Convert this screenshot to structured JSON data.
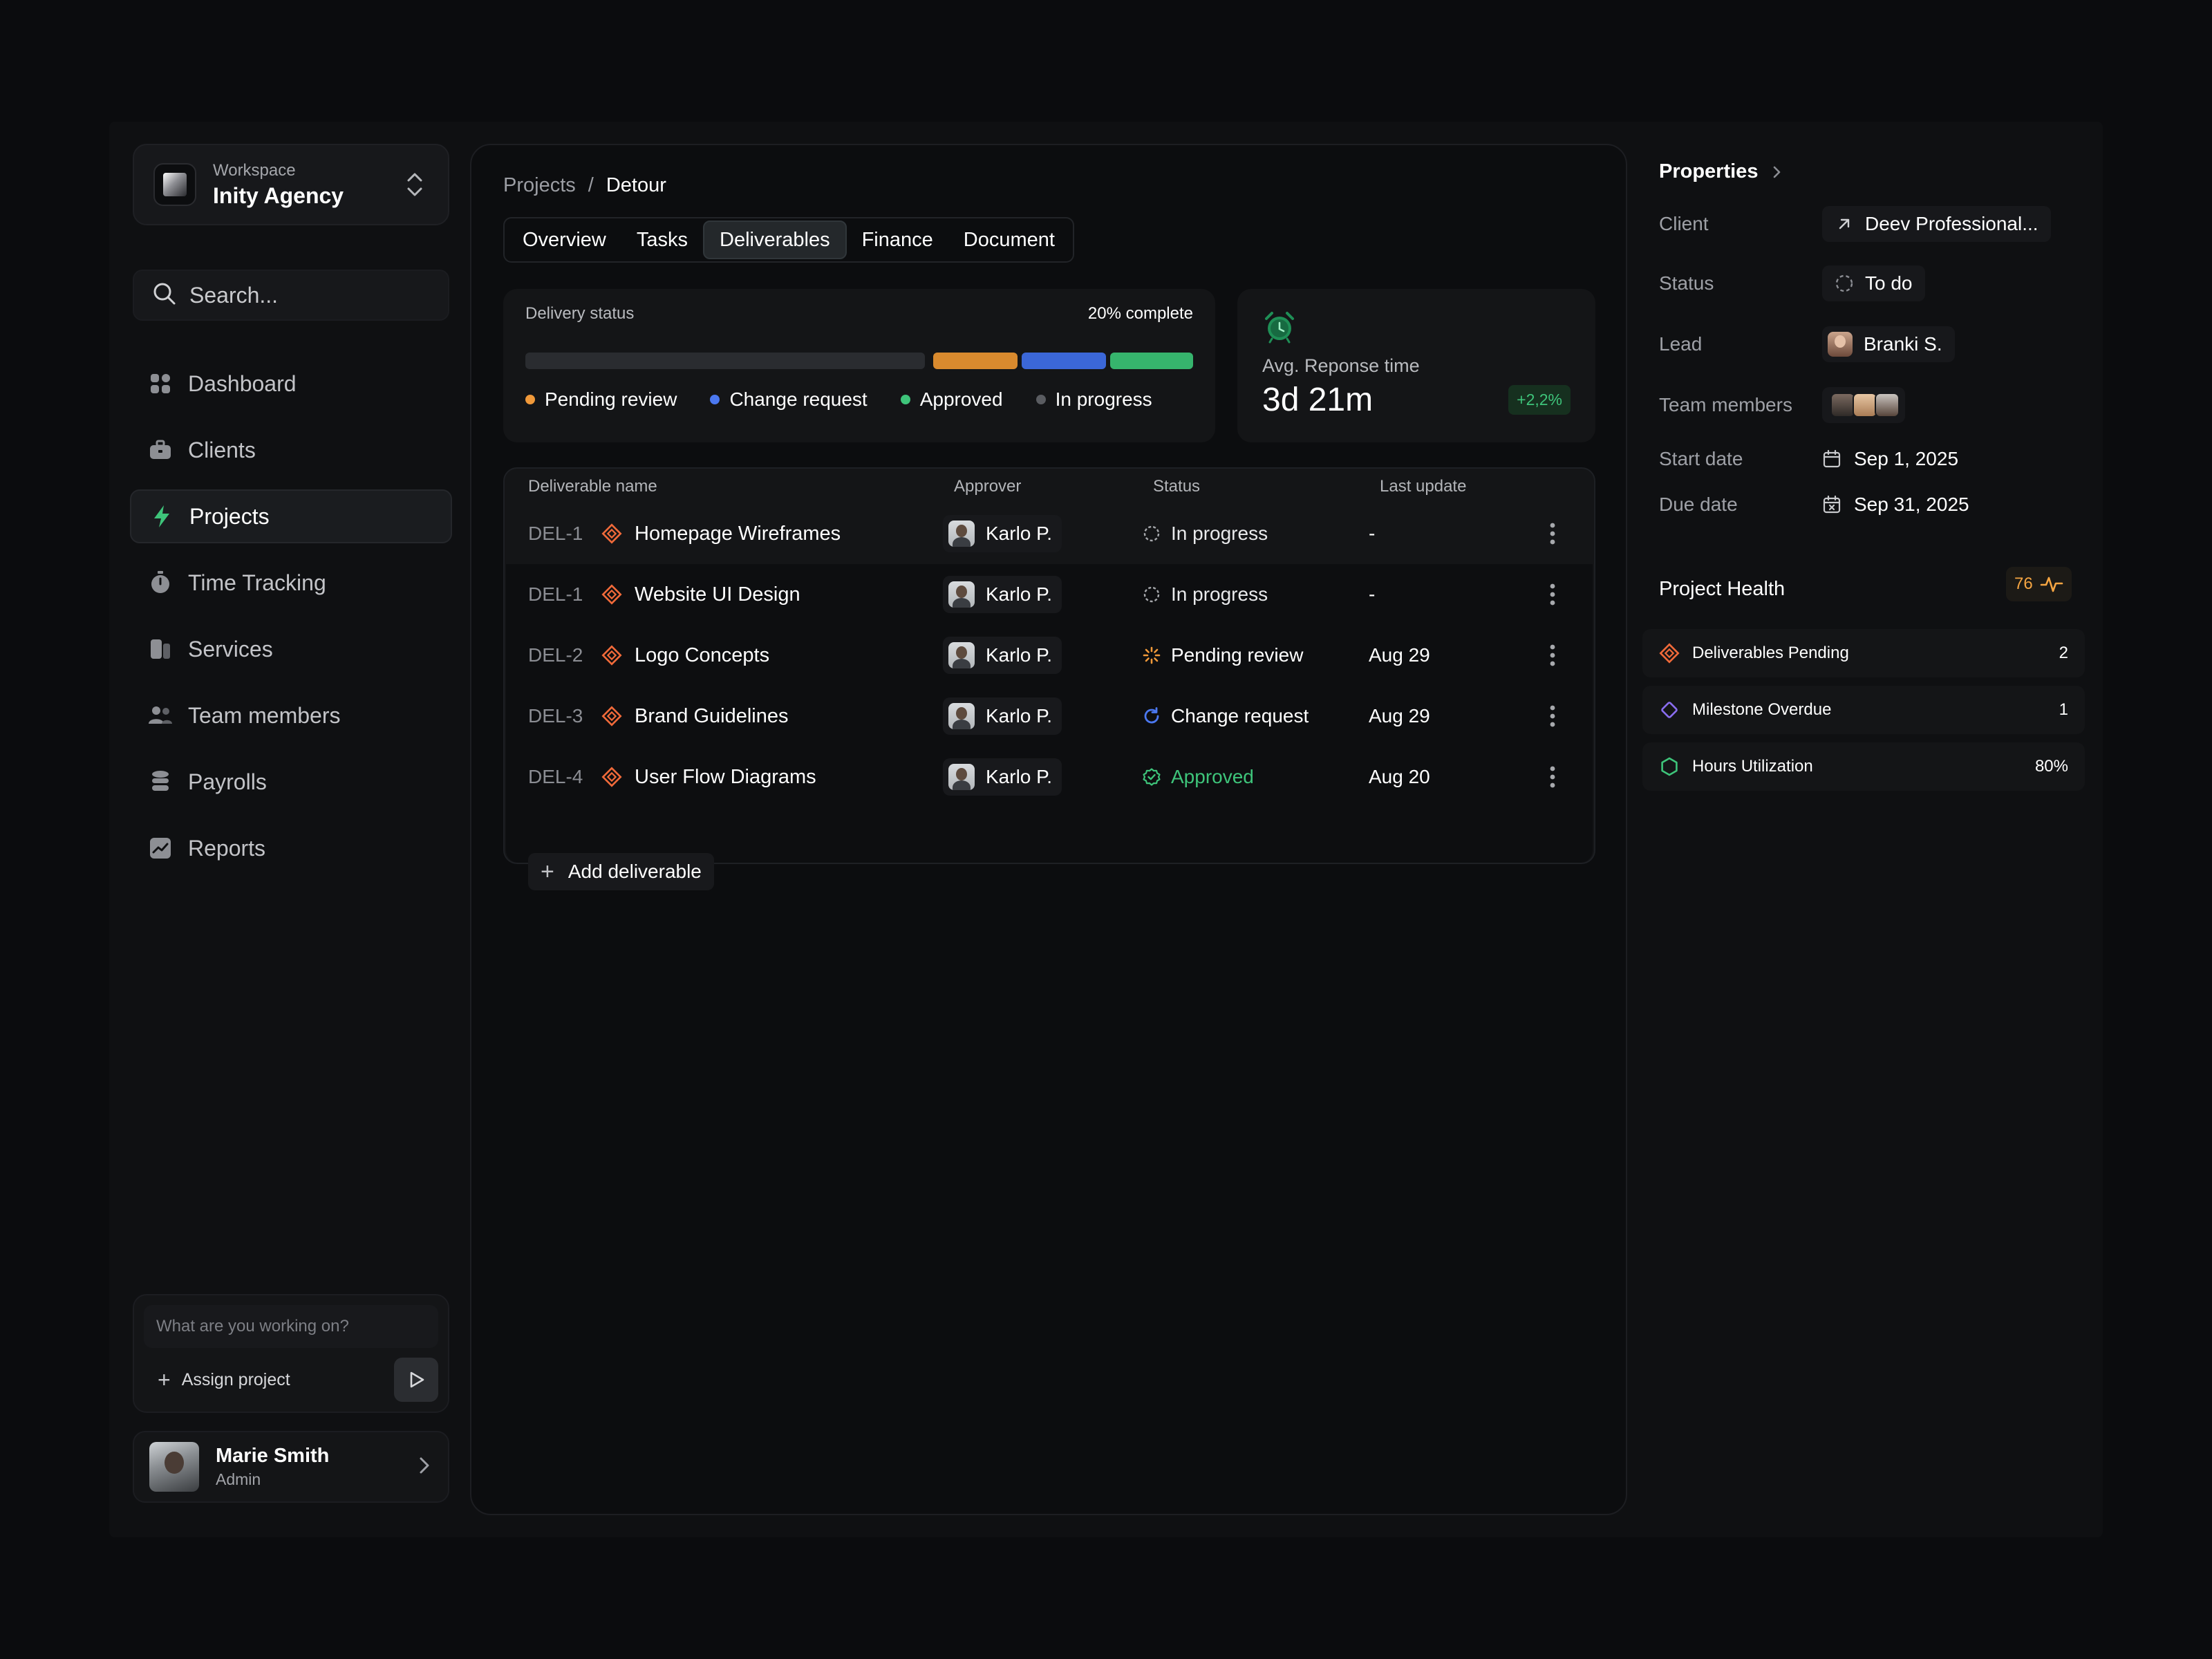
{
  "workspace": {
    "label": "Workspace",
    "name": "Inity Agency"
  },
  "search": {
    "placeholder": "Search..."
  },
  "nav": [
    {
      "label": "Dashboard",
      "icon": "dashboard-icon"
    },
    {
      "label": "Clients",
      "icon": "briefcase-icon"
    },
    {
      "label": "Projects",
      "icon": "bolt-icon",
      "active": true
    },
    {
      "label": "Time Tracking",
      "icon": "stopwatch-icon"
    },
    {
      "label": "Services",
      "icon": "services-icon"
    },
    {
      "label": "Team members",
      "icon": "team-icon"
    },
    {
      "label": "Payrolls",
      "icon": "coins-icon"
    },
    {
      "label": "Reports",
      "icon": "chart-icon"
    }
  ],
  "composer": {
    "placeholder": "What are you working on?",
    "assign_label": "Assign project"
  },
  "user": {
    "name": "Marie Smith",
    "role": "Admin"
  },
  "breadcrumb": {
    "parent": "Projects",
    "separator": "/",
    "current": "Detour"
  },
  "tabs": [
    "Overview",
    "Tasks",
    "Deliverables",
    "Finance",
    "Document"
  ],
  "active_tab": "Deliverables",
  "delivery": {
    "label": "Delivery status",
    "complete": "20% complete",
    "progress": 0.2,
    "legend": [
      {
        "label": "Pending review",
        "color": "#f0993a"
      },
      {
        "label": "Change request",
        "color": "#4b78f0"
      },
      {
        "label": "Approved",
        "color": "#3ec47a"
      },
      {
        "label": "In progress",
        "color": "#5a5c61"
      }
    ]
  },
  "response": {
    "label": "Avg. Reponse time",
    "value": "3d 21m",
    "delta": "+2,2%",
    "icon": "alarm-clock-icon"
  },
  "table": {
    "headers": {
      "name": "Deliverable name",
      "approver": "Approver",
      "status": "Status",
      "updated": "Last update"
    },
    "rows": [
      {
        "code": "DEL-1",
        "name": "Homepage Wireframes",
        "approver": "Karlo P.",
        "status": "In progress",
        "status_key": "progress",
        "updated": "-"
      },
      {
        "code": "DEL-1",
        "name": "Website UI Design",
        "approver": "Karlo P.",
        "status": "In progress",
        "status_key": "progress",
        "updated": "-"
      },
      {
        "code": "DEL-2",
        "name": "Logo Concepts",
        "approver": "Karlo P.",
        "status": "Pending review",
        "status_key": "pending",
        "updated": "Aug 29"
      },
      {
        "code": "DEL-3",
        "name": "Brand Guidelines",
        "approver": "Karlo P.",
        "status": "Change request",
        "status_key": "change",
        "updated": "Aug 29"
      },
      {
        "code": "DEL-4",
        "name": "User Flow Diagrams",
        "approver": "Karlo P.",
        "status": "Approved",
        "status_key": "approved",
        "updated": "Aug 20"
      }
    ],
    "add_label": "Add deliverable"
  },
  "status_colors": {
    "progress": "#e9eaec",
    "pending": "#ffffff",
    "change": "#ffffff",
    "approved": "#3ec47a"
  },
  "properties": {
    "title": "Properties",
    "client_label": "Client",
    "client": "Deev Professional...",
    "status_label": "Status",
    "status": "To do",
    "lead_label": "Lead",
    "lead": "Branki S.",
    "team_label": "Team members",
    "start_label": "Start date",
    "start": "Sep 1, 2025",
    "due_label": "Due date",
    "due": "Sep 31, 2025"
  },
  "health": {
    "title": "Project Health",
    "score": "76",
    "items": [
      {
        "label": "Deliverables Pending",
        "value": "2",
        "icon": "deliverable-icon"
      },
      {
        "label": "Milestone Overdue",
        "value": "1",
        "icon": "diamond-icon"
      },
      {
        "label": "Hours Utilization",
        "value": "80%",
        "icon": "hexagon-icon"
      }
    ]
  }
}
